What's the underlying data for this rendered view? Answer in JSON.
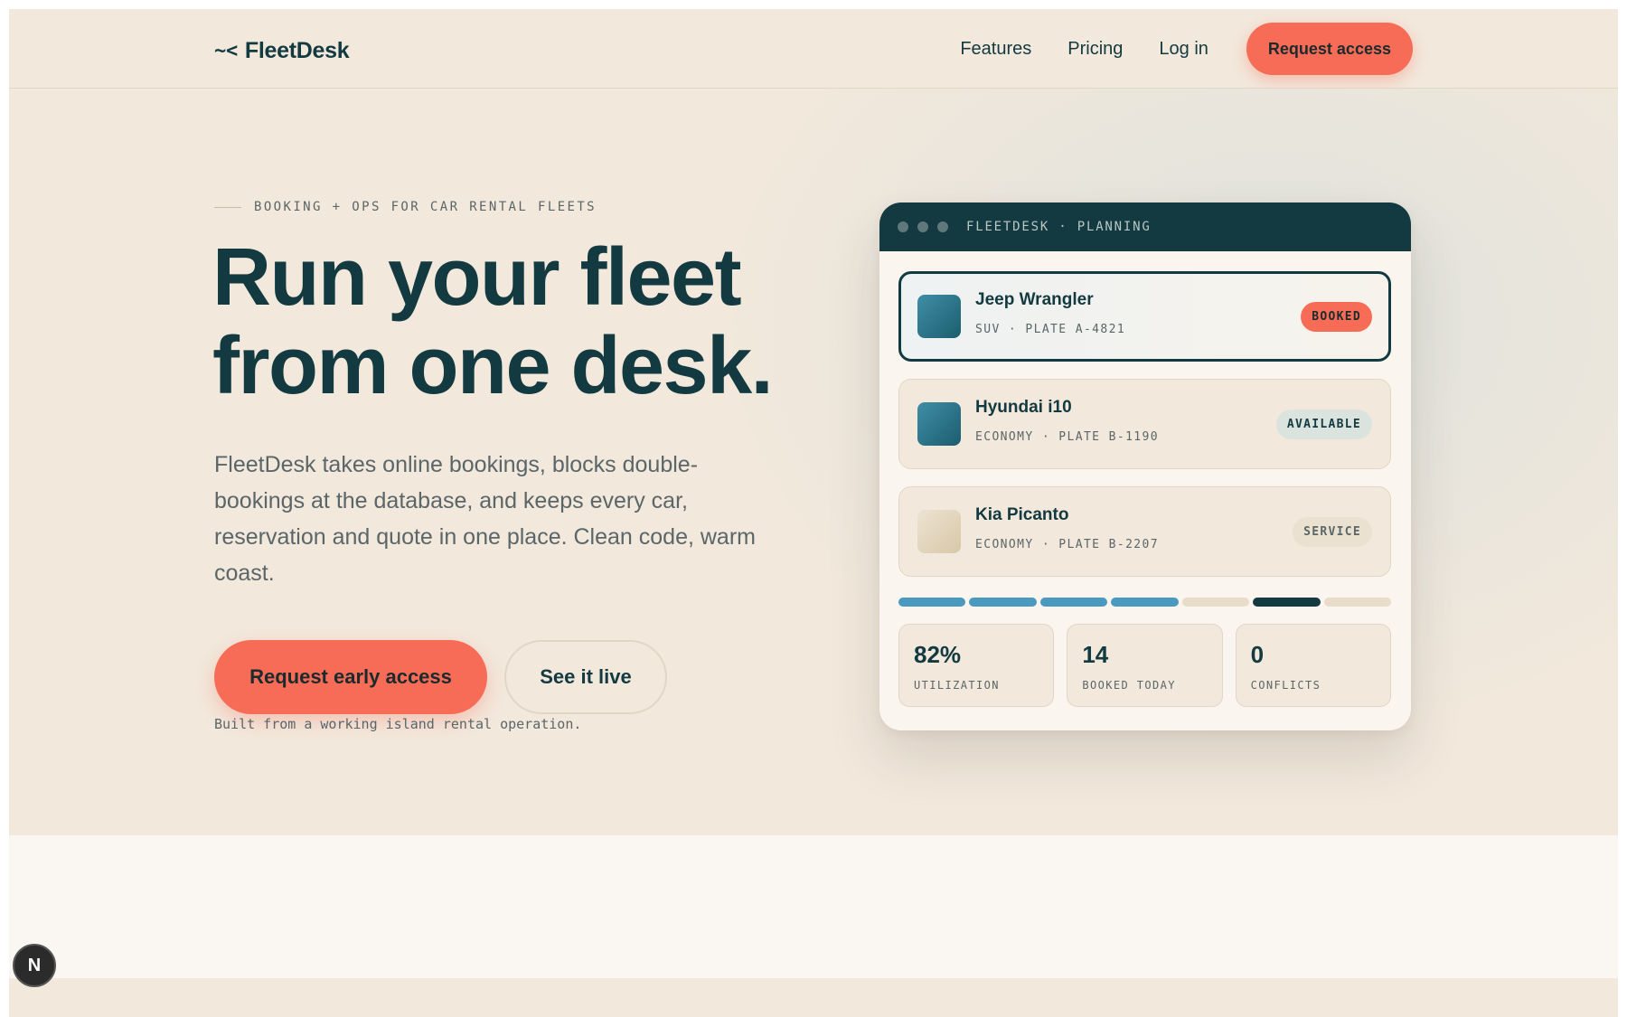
{
  "header": {
    "logo_mark": "~<",
    "logo_text": "FleetDesk",
    "nav": [
      "Features",
      "Pricing",
      "Log in"
    ],
    "cta": "Request access"
  },
  "hero": {
    "eyebrow": "BOOKING + OPS FOR CAR RENTAL FLEETS",
    "headline_line1": "Run your fleet",
    "headline_line2": "from one desk.",
    "lede": "FleetDesk takes online bookings, blocks double-bookings at the database, and keeps every car, reservation and quote in one place. Clean code, warm coast.",
    "primary_cta": "Request early access",
    "secondary_cta": "See it live",
    "footnote": "Built from a working island rental operation."
  },
  "planning_card": {
    "title": "FLEETDESK · PLANNING",
    "vehicles": [
      {
        "name": "Jeep Wrangler",
        "meta": "SUV · PLATE A-4821",
        "status": "BOOKED"
      },
      {
        "name": "Hyundai i10",
        "meta": "ECONOMY · PLATE B-1190",
        "status": "AVAILABLE"
      },
      {
        "name": "Kia Picanto",
        "meta": "ECONOMY · PLATE B-2207",
        "status": "SERVICE"
      }
    ],
    "timeline": [
      "booked",
      "booked",
      "booked",
      "booked",
      "free",
      "service",
      "free"
    ],
    "stats": [
      {
        "value": "82%",
        "label": "UTILIZATION"
      },
      {
        "value": "14",
        "label": "BOOKED TODAY"
      },
      {
        "value": "0",
        "label": "CONFLICTS"
      }
    ]
  },
  "dev_badge": "N",
  "colors": {
    "brand_dark": "#133a40",
    "accent_coral": "#f76c57",
    "background_sand": "#f2e8dc",
    "timeline_blue": "#4a9ac0"
  }
}
